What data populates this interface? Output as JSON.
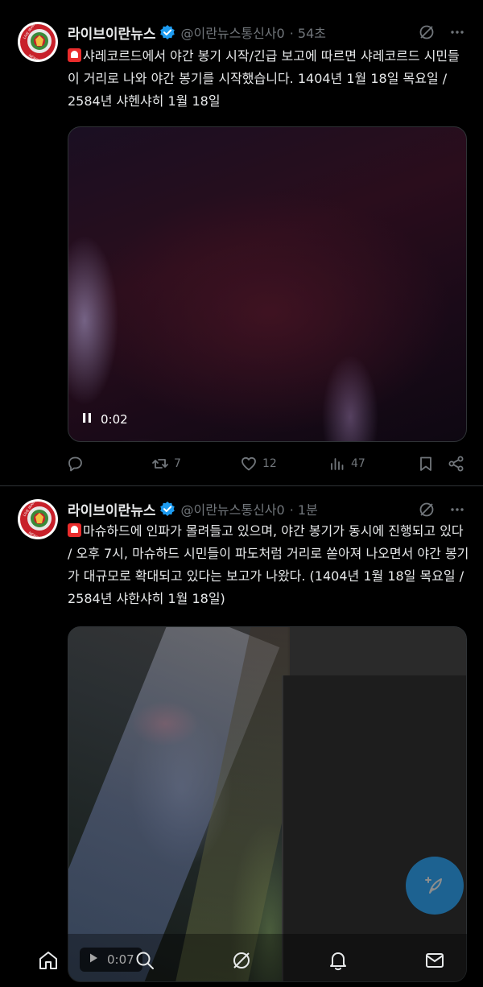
{
  "tweets": [
    {
      "author_name": "라이브이란뉴스",
      "handle": "@이란뉴스통신사0",
      "time": "· 54초",
      "text": "샤레코르드에서 야간 봉기 시작/긴급 보고에 따르면 샤레코르드 시민들이 거리로 나와 야간 봉기를 시작했습니다. 1404년 1월 18일 목요일 / 2584년 샤헨샤히 1월 18일",
      "video_time": "0:02",
      "video_state": "pause-icon",
      "replies": "",
      "reposts": "7",
      "likes": "12",
      "views": "47"
    },
    {
      "author_name": "라이브이란뉴스",
      "handle": "@이란뉴스통신사0",
      "time": "· 1분",
      "text": "마슈하드에 인파가 몰려들고 있으며, 야간 봉기가 동시에 진행되고 있다 / 오후 7시, 마슈하드 시민들이 파도처럼 거리로 쏟아져 나오면서 야간 봉기가 대규모로 확대되고 있다는 보고가 나왔다. (1404년 1월 18일 목요일 / 2584년 샤한샤히 1월 18일)",
      "video_time": "0:07",
      "video_state": "play-icon"
    }
  ],
  "avatar_text": {
    "top": "LIVE IRAN",
    "bottom": "NEWS"
  },
  "colors": {
    "accent": "#1d9bf0",
    "muted": "#71767b",
    "text": "#e7e9ea",
    "background": "#000000"
  },
  "nav": [
    "home-icon",
    "search-icon",
    "grok-icon",
    "notifications-icon",
    "messages-icon"
  ]
}
